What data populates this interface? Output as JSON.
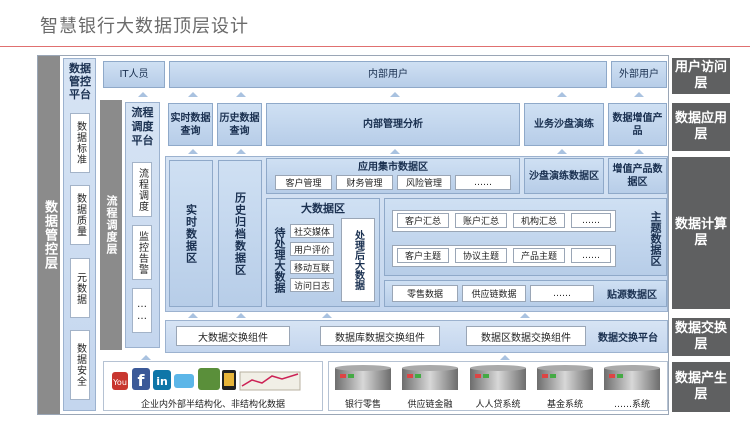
{
  "title": "智慧银行大数据顶层设计",
  "left_panel": {
    "outer_label": "数据管控层",
    "control_platform": "数据管控平台",
    "items": [
      "数据标准",
      "数据质量",
      "元数据",
      "数据安全"
    ]
  },
  "flow": {
    "outer_label": "流程调度层",
    "platform": "流程调度平台",
    "items": [
      "流程调度",
      "监控告警",
      "……"
    ]
  },
  "layers": {
    "access": "用户访问层",
    "app": "数据应用层",
    "compute": "数据计算层",
    "exchange": "数据交换层",
    "produce": "数据产生层"
  },
  "access_row": {
    "it": "IT人员",
    "internal": "内部用户",
    "external": "外部用户"
  },
  "app_row": {
    "realtime_query": "实时数据查询",
    "history_query": "历史数据查询",
    "internal_analysis": "内部管理分析",
    "sandbox": "业务沙盘演练",
    "value_added": "数据增值产品"
  },
  "compute": {
    "realtime_area": "实时数据区",
    "history_area": "历史归档数据区",
    "mart_title": "应用集市数据区",
    "mart_items": [
      "客户管理",
      "财务管理",
      "风险管理",
      "……"
    ],
    "sandbox_area": "沙盘演练数据区",
    "value_area": "增值产品数据区",
    "bigdata_title": "大数据区",
    "pending": "待处理大数据",
    "pending_items": [
      "社交媒体",
      "用户评价",
      "移动互联",
      "访问日志"
    ],
    "processed": "处理后大数据",
    "theme_label": "主题数据区",
    "theme_row1": [
      "客户汇总",
      "账户汇总",
      "机构汇总",
      "……"
    ],
    "theme_row2": [
      "客户主题",
      "协议主题",
      "产品主题",
      "……"
    ],
    "source_items": [
      "零售数据",
      "供应链数据",
      "……"
    ],
    "source_label": "贴源数据区"
  },
  "exchange": {
    "items": [
      "大数据交换组件",
      "数据库数据交换组件",
      "数据区数据交换组件"
    ],
    "platform": "数据交换平台"
  },
  "produce": {
    "unstructured_label": "企业内外部半结构化、非结构化数据",
    "systems": [
      "银行零售",
      "供应链金融",
      "人人贷系统",
      "基金系统",
      "……系统"
    ]
  },
  "colors": {
    "blue_light": "#cfe0f3",
    "gray_label": "#5f6061",
    "title_line": "#e07070"
  }
}
